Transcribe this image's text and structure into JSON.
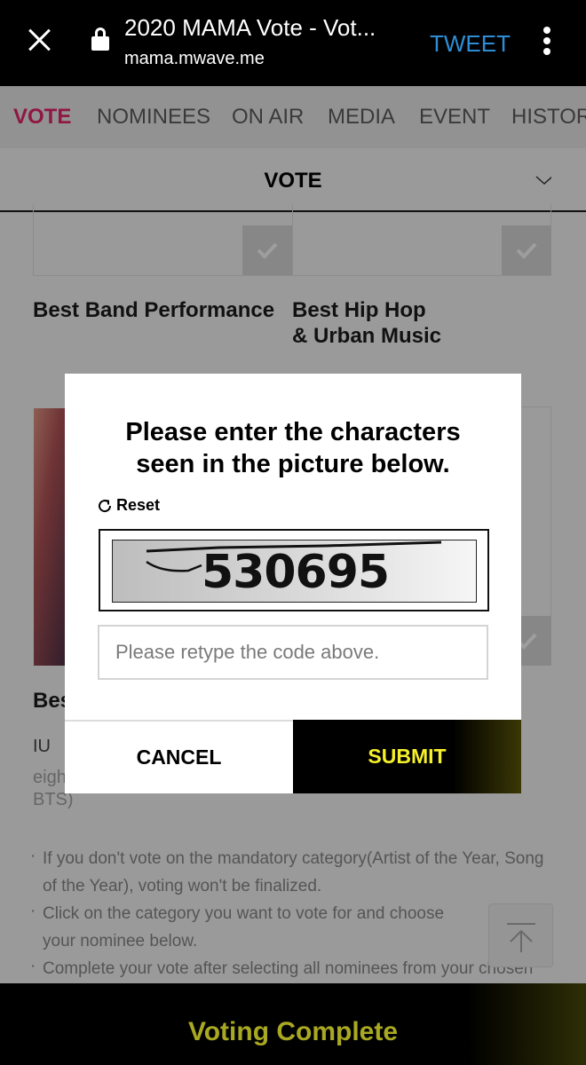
{
  "browser": {
    "title": "2020 MAMA Vote - Vot...",
    "url": "mama.mwave.me",
    "tweet_label": "TWEET",
    "icons": {
      "close": "close-icon",
      "lock": "lock-icon",
      "menu": "more-vert-icon"
    }
  },
  "nav": {
    "tabs": [
      {
        "label": "VOTE",
        "active": true
      },
      {
        "label": "NOMINEES",
        "active": false
      },
      {
        "label": "ON AIR",
        "active": false
      },
      {
        "label": "MEDIA",
        "active": false
      },
      {
        "label": "EVENT",
        "active": false
      },
      {
        "label": "HISTOR",
        "active": false
      }
    ],
    "active_color": "#8f1743"
  },
  "section_select": {
    "label": "VOTE",
    "icon": "chevron-down-icon"
  },
  "categories": [
    {
      "label": "Best Band Performance"
    },
    {
      "label_line1": "Best Hip Hop",
      "label_line2": "& Urban Music"
    }
  ],
  "partial_category": {
    "label_visible": "Bes",
    "nominee": "IU",
    "sub_line1": "eigh",
    "sub_line2": "BTS)"
  },
  "notes": [
    "If you don't vote on the mandatory category(Artist of the Year, Song of the Year), voting won't be finalized.",
    "Click on the category you want to vote for and choose your nominee below.",
    "Complete your vote after selecting all nominees from your chosen"
  ],
  "scroll_top": {
    "icon": "arrow-up-to-top-icon"
  },
  "bottom_bar": {
    "label": "Voting Complete",
    "color": "#a9a823"
  },
  "modal": {
    "heading_line1": "Please enter the characters",
    "heading_line2": "seen in the picture below.",
    "reset_label": "Reset",
    "captcha_code": "530695",
    "input_value": "",
    "input_placeholder": "Please retype the code above.",
    "cancel_label": "CANCEL",
    "submit_label": "SUBMIT",
    "submit_color": "#f4f02a"
  }
}
